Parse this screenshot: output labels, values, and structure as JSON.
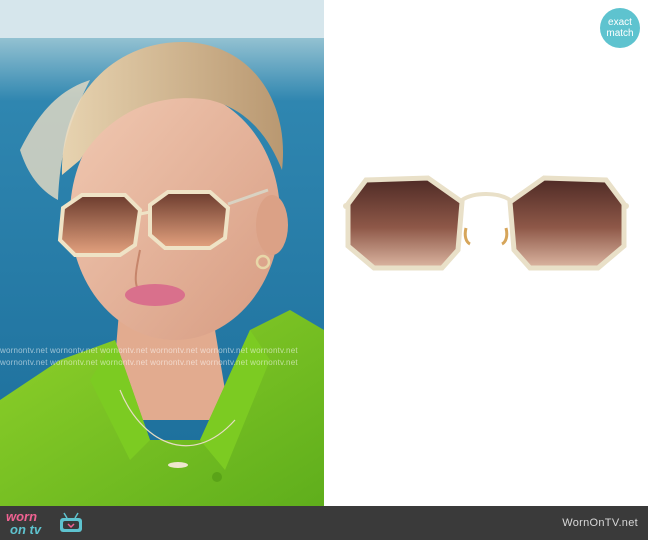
{
  "badge": {
    "line1": "exact",
    "line2": "match"
  },
  "watermark": {
    "row1": "wornontv.net  wornontv.net  wornontv.net  wornontv.net  wornontv.net  wornontv.net",
    "row2": "wornontv.net  wornontv.net  wornontv.net  wornontv.net  wornontv.net  wornontv.net"
  },
  "footer": {
    "logo_word1": "worn",
    "logo_word2": "on tv",
    "site": "WornOnTV.net"
  },
  "colors": {
    "badge": "#5ec3cf",
    "footer_bg": "#3a3a3a",
    "logo_pink": "#f06292",
    "logo_teal": "#5ec3cf"
  }
}
